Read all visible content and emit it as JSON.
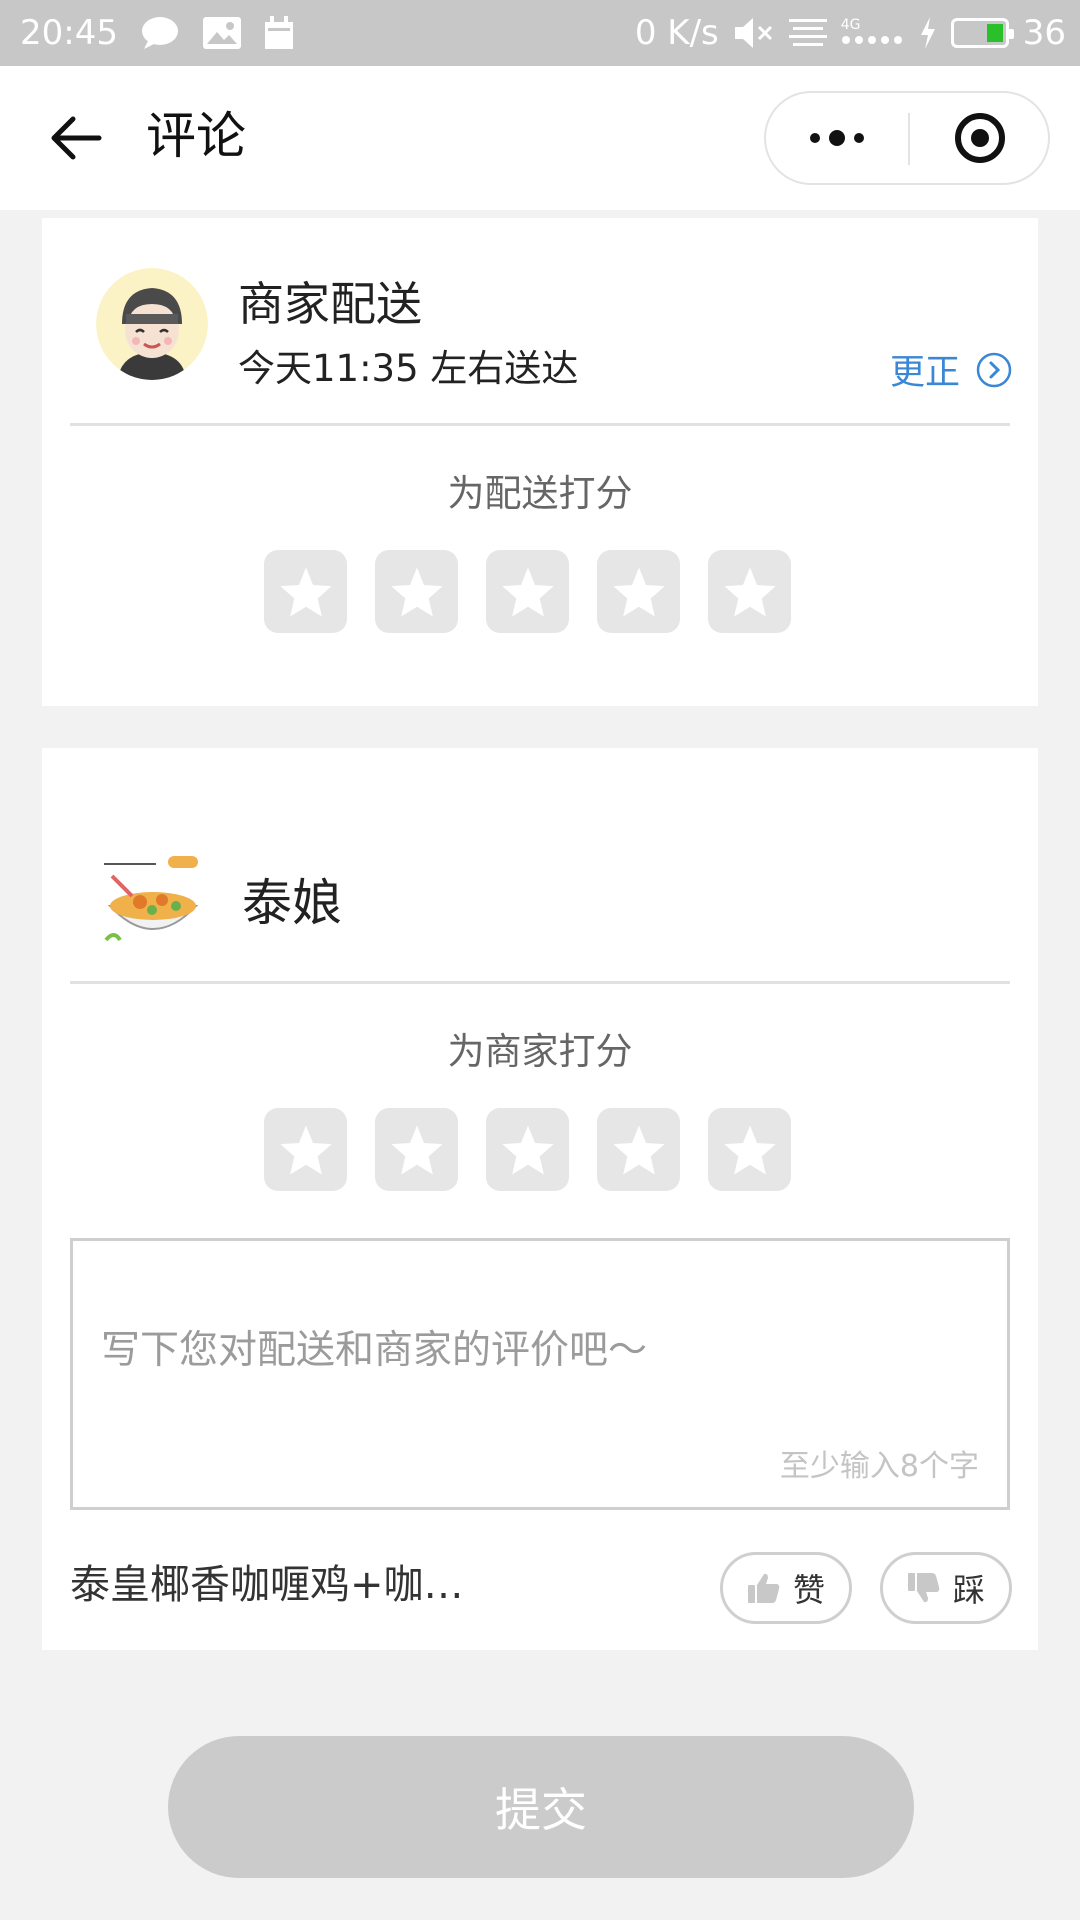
{
  "status_bar": {
    "time": "20:45",
    "network_speed": "0 K/s",
    "network_type": "4G",
    "battery_level": "36",
    "icons": [
      "chat-bubble-icon",
      "image-icon",
      "calendar-icon",
      "mute-icon",
      "data-icon",
      "signal-icon",
      "charging-icon",
      "battery-icon"
    ]
  },
  "nav": {
    "title": "评论",
    "back_icon": "arrow-left-icon",
    "more_icon": "more-dots-icon",
    "close_icon": "target-close-icon"
  },
  "delivery": {
    "title": "商家配送",
    "eta": "今天11:35 左右送达",
    "change_label": "更正",
    "rate_label": "为配送打分",
    "rating": 0,
    "max_rating": 5
  },
  "merchant": {
    "name": "泰娘",
    "rate_label": "为商家打分",
    "rating": 0,
    "max_rating": 5,
    "comment": {
      "value": "",
      "placeholder": "写下您对配送和商家的评价吧～",
      "hint": "至少输入8个字"
    },
    "dish": {
      "name": "泰皇椰香咖喱鸡+咖…",
      "like_label": "赞",
      "dislike_label": "踩"
    }
  },
  "submit_label": "提交",
  "colors": {
    "accent_link": "#3a87d6",
    "status_bar": "#c7c7c7",
    "submit_disabled": "#cbcbcb",
    "star_bg": "#e6e6e6",
    "battery": "#29c02a"
  }
}
